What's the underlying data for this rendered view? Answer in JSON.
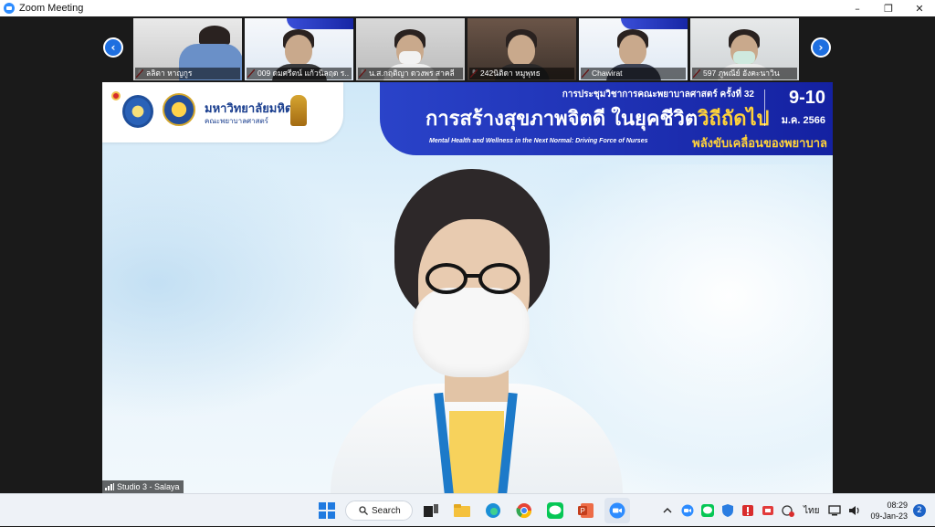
{
  "window": {
    "title": "Zoom Meeting",
    "minimize": "–",
    "restore": "❐",
    "close": "✕"
  },
  "gallery": {
    "prev_arrow": "‹",
    "next_arrow": "›",
    "participants": [
      {
        "name": "ลลิตา หาญกูร",
        "shirt": "#6a90c8"
      },
      {
        "name": "009 ดมศรีตน์ แก้วนิลฤด ร..",
        "shirt": "#3a3b3d"
      },
      {
        "name": "น.ส.กฤติญา ดวงพร สาคลี",
        "shirt": "#efefef"
      },
      {
        "name": "242นิติดา หมูพุทธ",
        "shirt": "#2c2a2a"
      },
      {
        "name": "Chawirat",
        "shirt": "#3d4354"
      },
      {
        "name": "597 ภูพณีย์ อังคะนาวิน",
        "shirt": "#eaeaea"
      }
    ]
  },
  "slide": {
    "university_th": "มหาวิทยาลัยมหิดล",
    "faculty_th": "คณะพยาบาลศาสตร์",
    "conference_th": "การประชุมวิชาการคณะพยาบาลศาสตร์ ครั้งที่ 32",
    "headline_th_main": "การสร้างสุขภาพจิตดี ในยุคชีวิต",
    "headline_th_accent": "วิถีถัดไป",
    "date_days": "9-10",
    "date_month": "ม.ค. 2566",
    "subtitle_en": "Mental Health and Wellness in the Next Normal: Driving Force of Nurses",
    "subtitle_th": "พลังขับเคลื่อนของพยาบาล"
  },
  "speaker_label": "Studio 3 - Salaya",
  "taskbar": {
    "search_label": "Search",
    "language": "ไทย",
    "time": "08:29",
    "date": "09-Jan-23",
    "notification_count": "2"
  }
}
